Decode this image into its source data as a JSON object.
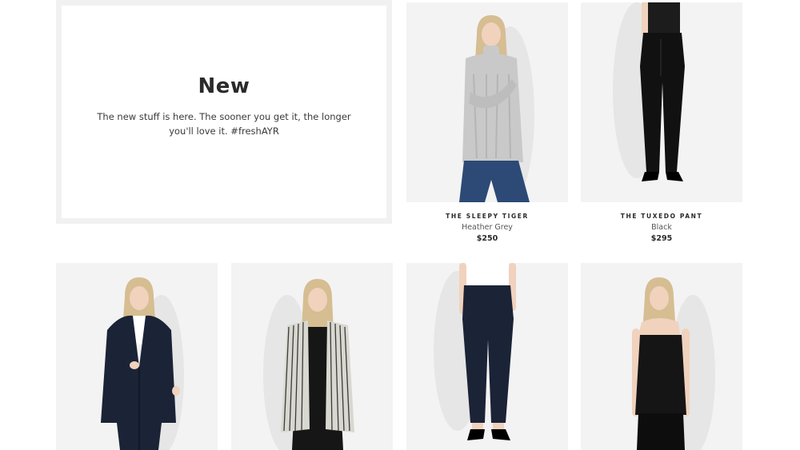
{
  "intro": {
    "title": "New",
    "text": "The new stuff is here. The sooner you get it, the longer you'll love it. #freshAYR"
  },
  "products": [
    {
      "name": "THE SLEEPY TIGER",
      "color": "Heather Grey",
      "price": "$250",
      "image": "model in grey cable-knit turtleneck sweater and blue jeans"
    },
    {
      "name": "THE TUXEDO PANT",
      "color": "Black",
      "price": "$295",
      "image": "black tuxedo trousers with black top"
    },
    {
      "image": "model in navy blazer and pants suit"
    },
    {
      "image": "model in striped knit vest cardigan with black outfit"
    },
    {
      "image": "navy cropped trousers with white top and black heels"
    },
    {
      "image": "model in black camisole top and black pants"
    }
  ],
  "colors": {
    "tile_bg": "#f3f3f3",
    "intro_frame": "#f1f1f1",
    "text_dark": "#2a2a2a",
    "denim": "#2c4a75",
    "navy": "#1b2336",
    "sweater_grey": "#c9c9c9",
    "skin": "#f0d2bd",
    "hair": "#d6bd92"
  }
}
